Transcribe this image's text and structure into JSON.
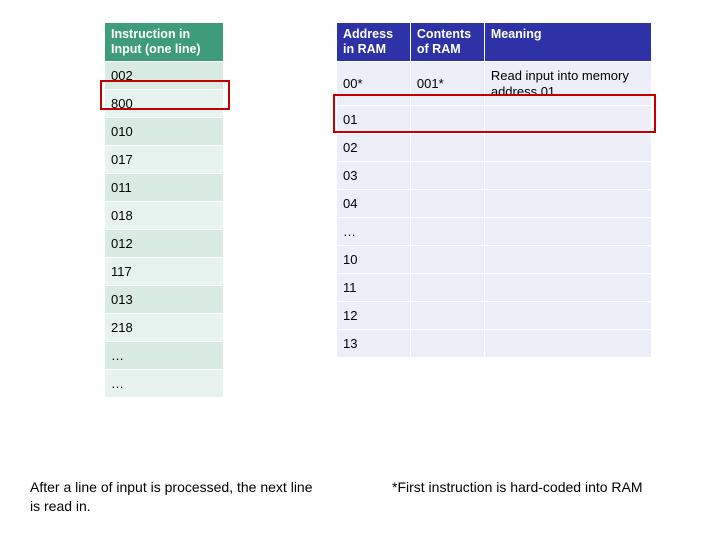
{
  "left": {
    "header": "Instruction in Input (one line)",
    "rows": [
      "002",
      "800",
      "010",
      "017",
      "011",
      "018",
      "012",
      "117",
      "013",
      "218",
      "…",
      "…"
    ]
  },
  "right": {
    "headers": {
      "addr": "Address in RAM",
      "cont": "Contents of RAM",
      "mean": "Meaning"
    },
    "rows": [
      {
        "addr": "00*",
        "cont": "001*",
        "mean": "Read input into memory address 01"
      },
      {
        "addr": "01",
        "cont": "",
        "mean": ""
      },
      {
        "addr": "02",
        "cont": "",
        "mean": ""
      },
      {
        "addr": "03",
        "cont": "",
        "mean": ""
      },
      {
        "addr": "04",
        "cont": "",
        "mean": ""
      },
      {
        "addr": "…",
        "cont": "",
        "mean": ""
      },
      {
        "addr": "10",
        "cont": "",
        "mean": ""
      },
      {
        "addr": "11",
        "cont": "",
        "mean": ""
      },
      {
        "addr": "12",
        "cont": "",
        "mean": ""
      },
      {
        "addr": "13",
        "cont": "",
        "mean": ""
      }
    ]
  },
  "notes": {
    "left": "After a line of input is processed, the next line is read in.",
    "right": "*First instruction is hard-coded into RAM"
  },
  "chart_data": {
    "type": "table",
    "left_table": {
      "column": "Instruction in Input (one line)",
      "values": [
        "002",
        "800",
        "010",
        "017",
        "011",
        "018",
        "012",
        "117",
        "013",
        "218",
        "…",
        "…"
      ],
      "highlighted_row_index": 0
    },
    "right_table": {
      "columns": [
        "Address in RAM",
        "Contents of RAM",
        "Meaning"
      ],
      "rows": [
        [
          "00*",
          "001*",
          "Read input into memory address 01"
        ],
        [
          "01",
          "",
          ""
        ],
        [
          "02",
          "",
          ""
        ],
        [
          "03",
          "",
          ""
        ],
        [
          "04",
          "",
          ""
        ],
        [
          "…",
          "",
          ""
        ],
        [
          "10",
          "",
          ""
        ],
        [
          "11",
          "",
          ""
        ],
        [
          "12",
          "",
          ""
        ],
        [
          "13",
          "",
          ""
        ]
      ],
      "highlighted_row_index": 0
    }
  }
}
